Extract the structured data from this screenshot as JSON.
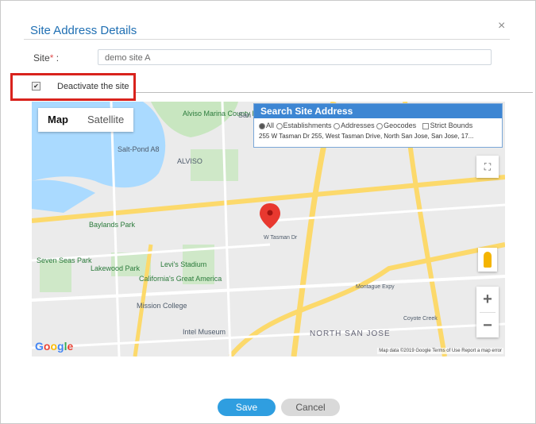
{
  "dialog": {
    "title": "Site Address Details",
    "close_glyph": "×",
    "site_label": "Site",
    "site_required_mark": "*",
    "site_colon": ":",
    "site_value": "demo site A",
    "deactivate_label": "Deactivate the site",
    "deactivate_checked": true,
    "highlight_color": "#d9231d"
  },
  "map": {
    "type_buttons": [
      "Map",
      "Satellite"
    ],
    "active_type": "Map",
    "search": {
      "header": "Search Site Address",
      "options": [
        "All",
        "Establishments",
        "Addresses",
        "Geocodes"
      ],
      "strict_bounds": "Strict Bounds",
      "address": "255 W Tasman Dr  255, West Tasman Drive, North San Jose, San Jose, 17..."
    },
    "labels": {
      "alviso_park": "Alviso Marina County Park",
      "salt_pond": "Salt-Pond A8",
      "alviso": "ALVISO",
      "baylands": "Baylands Park",
      "seven_seas": "Seven Seas Park",
      "lakewood": "Lakewood Park",
      "levis": "Levi's Stadium",
      "great_america": "California's Great America",
      "mission": "Mission College",
      "intel": "Intel Museum",
      "north_sj": "NORTH SAN JOSE",
      "tasman": "W Tasman Dr",
      "montague": "Montague Expy",
      "coyote": "Coyote Creek",
      "san": "San"
    },
    "google_logo": "Google",
    "footer": "Map data ©2019 Google   Terms of Use   Report a map error",
    "zoom_in": "+",
    "zoom_out": "−",
    "fullscreen_glyph": "⛶",
    "accent_color": "#3d86d3"
  },
  "buttons": {
    "save": "Save",
    "cancel": "Cancel"
  }
}
